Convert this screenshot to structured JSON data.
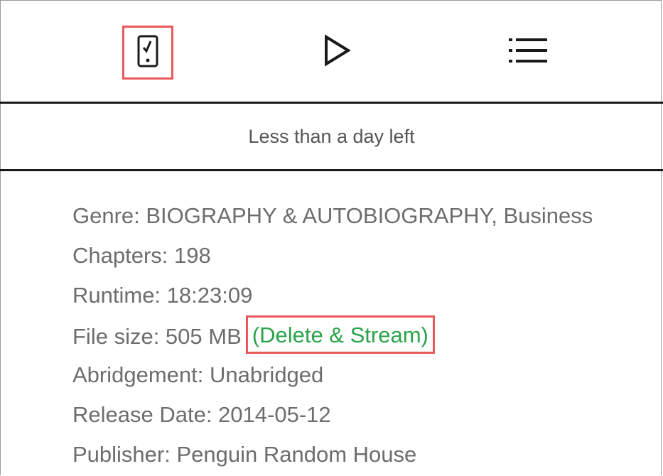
{
  "toolbar": {
    "items": [
      {
        "name": "device-downloaded",
        "icon": "phone-check-icon"
      },
      {
        "name": "play",
        "icon": "play-icon"
      },
      {
        "name": "chapters",
        "icon": "list-icon"
      }
    ]
  },
  "status": {
    "text": "Less than a day left"
  },
  "details": {
    "genre": "Genre: BIOGRAPHY & AUTOBIOGRAPHY, Business",
    "chapters": "Chapters: 198",
    "runtime": "Runtime: 18:23:09",
    "file_size": "File size: 505 MB",
    "delete_stream": "(Delete & Stream)",
    "abridgement": "Abridgement: Unabridged",
    "release_date": "Release Date: 2014-05-12",
    "publisher": "Publisher: Penguin Random House"
  },
  "colors": {
    "highlight": "#e9585a",
    "link": "#2ba34a",
    "text": "#6d6d6d",
    "rule": "#1a1a1a"
  }
}
